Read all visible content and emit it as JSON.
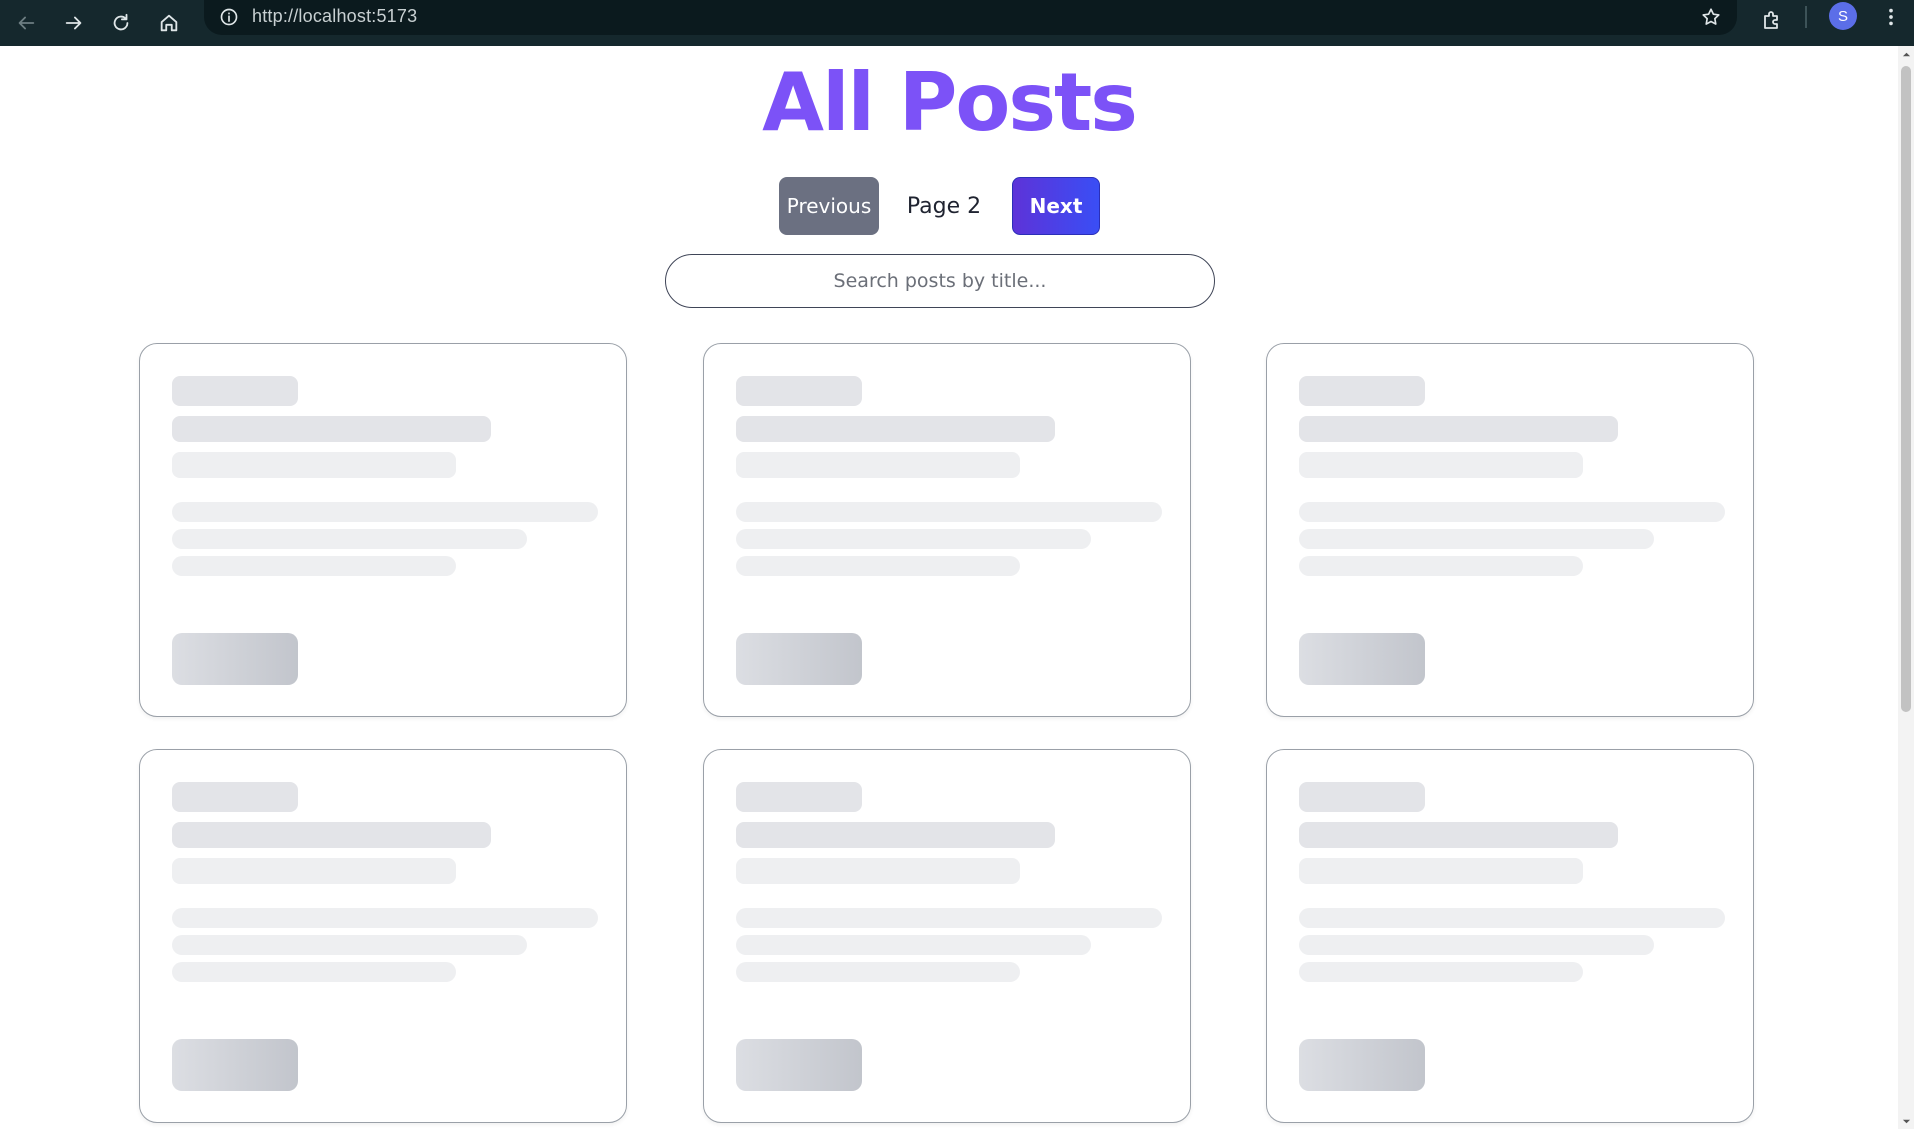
{
  "browser": {
    "url": "http://localhost:5173",
    "profile_initial": "S",
    "icons": [
      "back-arrow-icon",
      "forward-arrow-icon",
      "reload-icon",
      "home-icon",
      "site-info-icon",
      "bookmark-star-icon",
      "extensions-icon",
      "menu-dots-icon"
    ]
  },
  "page": {
    "title": "All Posts",
    "title_color": "#7c52f7"
  },
  "pagination": {
    "previous_label": "Previous",
    "page_label": "Page 2",
    "next_label": "Next",
    "previous_color": "#6b7081",
    "next_color": "#4a3fe6"
  },
  "search": {
    "placeholder": "Search posts by title...",
    "value": ""
  },
  "posts": {
    "state": "loading",
    "skeleton_card_count": 6
  }
}
